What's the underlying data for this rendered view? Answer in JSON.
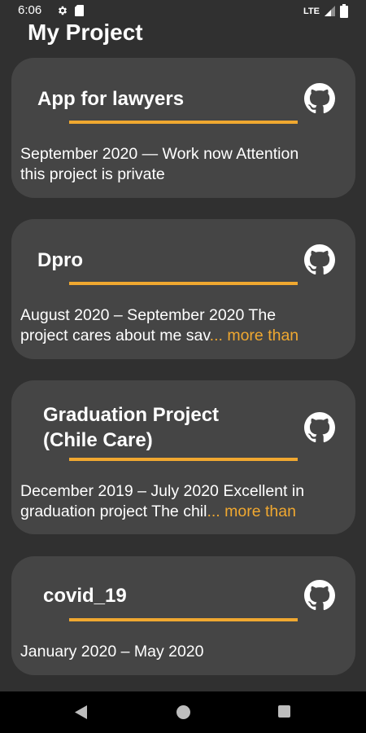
{
  "status_bar": {
    "time": "6:06",
    "network": "LTE",
    "icons": [
      "gear-icon",
      "sd-card-icon",
      "signal-icon",
      "battery-icon"
    ]
  },
  "page": {
    "title": "My Project"
  },
  "projects": [
    {
      "title_lines": [
        "App for lawyers"
      ],
      "desc_lines": [
        "September 2020 — Work now Attention",
        "this project is private"
      ],
      "more_label": "",
      "icon": "github-icon"
    },
    {
      "title_lines": [
        "Dpro"
      ],
      "desc_lines": [
        " August 2020 – September 2020 The",
        "project cares about me sav"
      ],
      "more_label": "... more than",
      "icon": "github-icon"
    },
    {
      "title_lines": [
        "Graduation Project",
        "(Chile Care)"
      ],
      "desc_lines": [
        " December 2019 – July 2020  Excellent in",
        "graduation project  The chil"
      ],
      "more_label": "... more than",
      "icon": "github-icon"
    },
    {
      "title_lines": [
        "covid_19"
      ],
      "desc_lines": [
        " January 2020 – May 2020"
      ],
      "more_label": "",
      "icon": "github-icon"
    }
  ],
  "colors": {
    "background": "#303030",
    "card": "#454545",
    "accent": "#f0a830",
    "nav_bar": "#000000"
  },
  "nav_bar": {
    "icons": [
      "back-icon",
      "home-icon",
      "recents-icon"
    ]
  }
}
